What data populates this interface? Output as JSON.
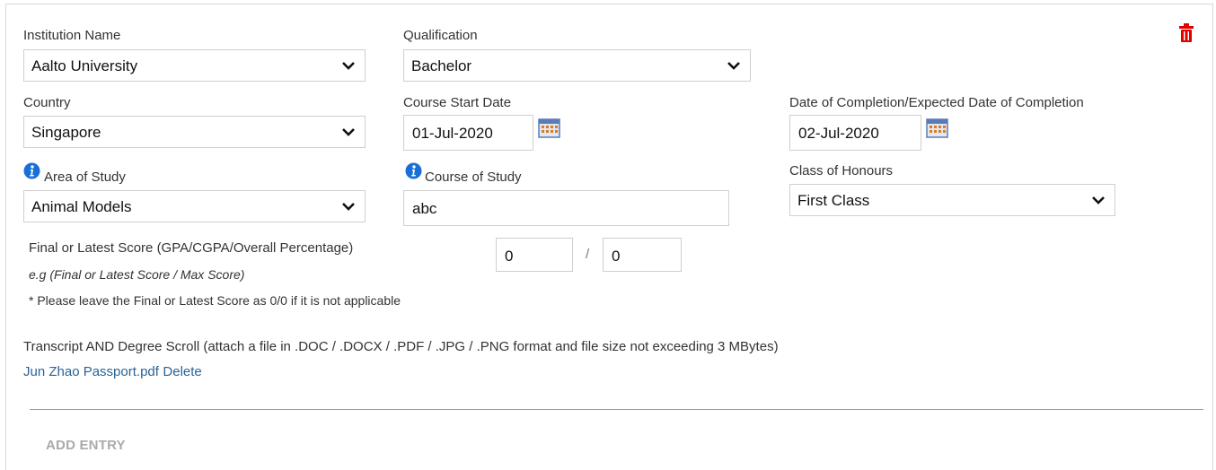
{
  "institution": {
    "label": "Institution Name",
    "value": "Aalto University"
  },
  "qualification": {
    "label": "Qualification",
    "value": "Bachelor"
  },
  "country": {
    "label": "Country",
    "value": "Singapore"
  },
  "course_start": {
    "label": "Course Start Date",
    "value": "01-Jul-2020"
  },
  "completion": {
    "label": "Date of Completion/Expected Date of Completion",
    "value": "02-Jul-2020"
  },
  "area_of_study": {
    "label": "Area of Study",
    "value": "Animal Models"
  },
  "course_of_study": {
    "label": "Course of Study",
    "value": "abc"
  },
  "class_of_honours": {
    "label": "Class of Honours",
    "value": "First Class"
  },
  "score": {
    "label": "Final or Latest Score (GPA/CGPA/Overall Percentage)",
    "example": "e.g (Final or Latest Score / Max Score)",
    "note": "* Please leave the Final or Latest Score as 0/0 if it is not applicable",
    "score_value": "0",
    "separator": "/",
    "max_value": "0"
  },
  "transcript": {
    "label": "Transcript AND Degree Scroll (attach a file in .DOC / .DOCX / .PDF / .JPG / .PNG format and file size not exceeding 3 MBytes)",
    "file_name": "Jun Zhao Passport.pdf",
    "delete_label": "Delete"
  },
  "add_entry_label": "ADD ENTRY",
  "colors": {
    "trash": "#e00000",
    "link": "#2a6496",
    "info": "#1a6fd6"
  }
}
